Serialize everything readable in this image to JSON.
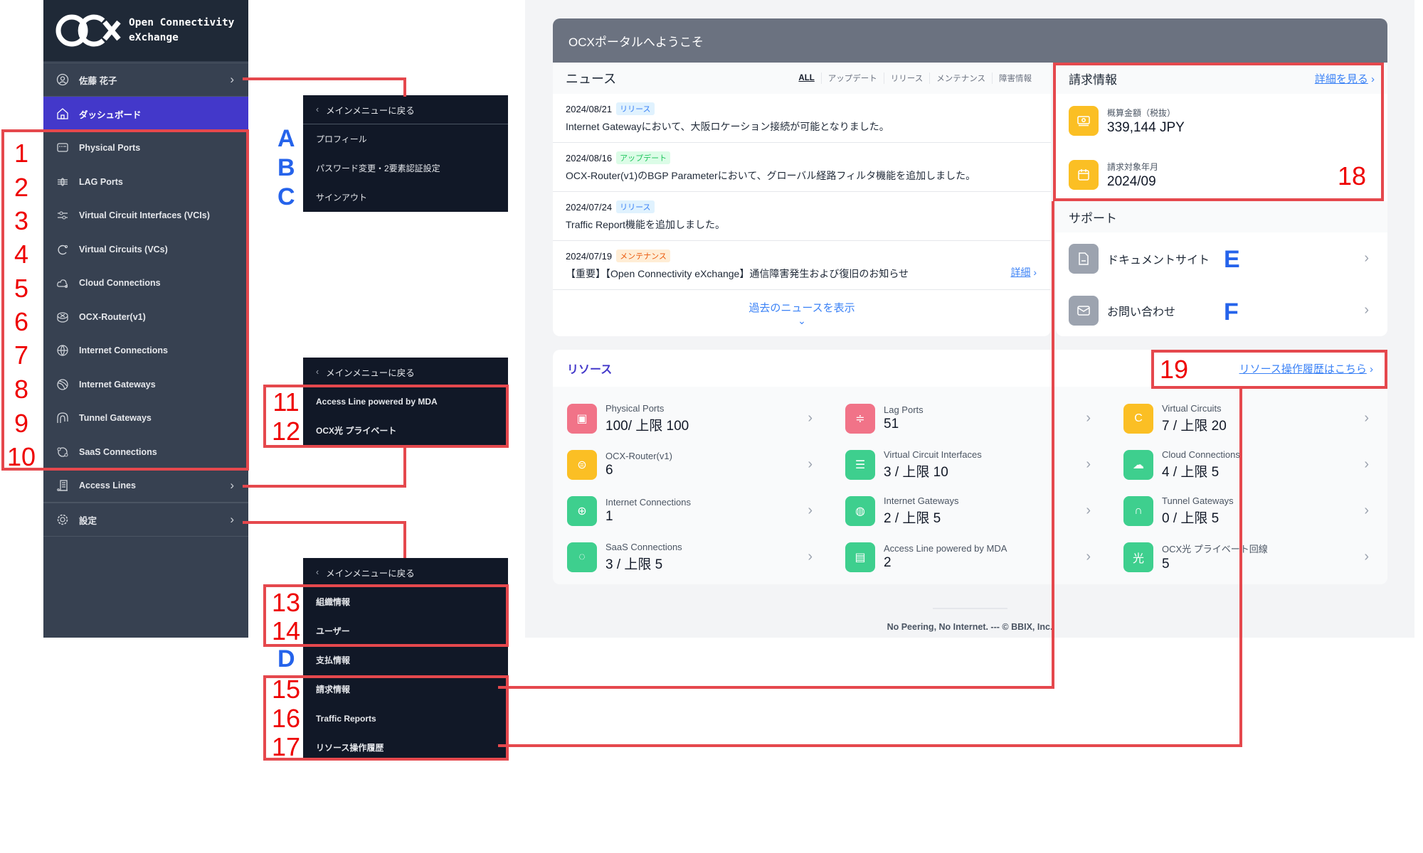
{
  "sidebar": {
    "brand_line1": "Open Connectivity",
    "brand_line2": "eXchange",
    "user_name": "佐藤 花子",
    "dashboard": "ダッシュボード",
    "items": [
      {
        "label": "Physical Ports",
        "icon": "ethernet-port-icon"
      },
      {
        "label": "LAG Ports",
        "icon": "lag-icon"
      },
      {
        "label": "Virtual Circuit Interfaces (VCIs)",
        "icon": "sliders-icon"
      },
      {
        "label": "Virtual Circuits (VCs)",
        "icon": "circuit-icon"
      },
      {
        "label": "Cloud Connections",
        "icon": "cloud-icon"
      },
      {
        "label": "OCX-Router(v1)",
        "icon": "router-icon"
      },
      {
        "label": "Internet Connections",
        "icon": "globe-icon"
      },
      {
        "label": "Internet Gateways",
        "icon": "gateway-icon"
      },
      {
        "label": "Tunnel Gateways",
        "icon": "tunnel-icon"
      },
      {
        "label": "SaaS Connections",
        "icon": "saas-icon"
      }
    ],
    "access_lines": "Access Lines",
    "settings": "設定"
  },
  "popups": {
    "back_label": "メインメニューに戻る",
    "user_menu": [
      "プロフィール",
      "パスワード変更・2要素認証設定",
      "サインアウト"
    ],
    "access_menu": [
      "Access Line powered by MDA",
      "OCX光 プライベート"
    ],
    "settings_menu": [
      "組織情報",
      "ユーザー",
      "支払情報",
      "請求情報",
      "Traffic Reports",
      "リソース操作履歴"
    ]
  },
  "annotations": {
    "numbers": [
      "1",
      "2",
      "3",
      "4",
      "5",
      "6",
      "7",
      "8",
      "9",
      "10",
      "11",
      "12",
      "13",
      "14",
      "15",
      "16",
      "17",
      "18",
      "19"
    ],
    "letters": [
      "A",
      "B",
      "C",
      "D",
      "E",
      "F"
    ]
  },
  "main": {
    "welcome": "OCXポータルへようこそ",
    "news": {
      "title": "ニュース",
      "tabs": [
        "ALL",
        "アップデート",
        "リリース",
        "メンテナンス",
        "障害情報"
      ],
      "items": [
        {
          "date": "2024/08/21",
          "tag": "リリース",
          "text": "Internet Gatewayにおいて、大阪ロケーション接続が可能となりました。"
        },
        {
          "date": "2024/08/16",
          "tag": "アップデート",
          "text": "OCX-Router(v1)のBGP Parameterにおいて、グローバル経路フィルタ機能を追加しました。"
        },
        {
          "date": "2024/07/24",
          "tag": "リリース",
          "text": "Traffic Report機能を追加しました。"
        },
        {
          "date": "2024/07/19",
          "tag": "メンテナンス",
          "text": "【重要】【Open Connectivity eXchange】通信障害発生および復旧のお知らせ",
          "link": "詳細"
        }
      ],
      "more": "過去のニュースを表示"
    },
    "billing": {
      "title": "請求情報",
      "link": "詳細を見る",
      "amount_label": "概算金額（税抜）",
      "amount": "339,144 JPY",
      "period_label": "請求対象年月",
      "period": "2024/09"
    },
    "support": {
      "title": "サポート",
      "items": [
        "ドキュメントサイト",
        "お問い合わせ"
      ]
    },
    "resources": {
      "title": "リソース",
      "link": "リソース操作履歴はこちら",
      "items": [
        {
          "label": "Physical Ports",
          "value": "100/ 上限 100",
          "color": "#f17388"
        },
        {
          "label": "Lag Ports",
          "value": "51",
          "color": "#f17388"
        },
        {
          "label": "Virtual Circuits",
          "value": "7 / 上限 20",
          "color": "#fbbf24"
        },
        {
          "label": "OCX-Router(v1)",
          "value": "6",
          "color": "#fbbf24"
        },
        {
          "label": "Virtual Circuit Interfaces",
          "value": "3 / 上限 10",
          "color": "#3ecf8e"
        },
        {
          "label": "Cloud Connections",
          "value": "4 / 上限 5",
          "color": "#3ecf8e"
        },
        {
          "label": "Internet Connections",
          "value": "1",
          "color": "#3ecf8e"
        },
        {
          "label": "Internet Gateways",
          "value": "2 / 上限 5",
          "color": "#3ecf8e"
        },
        {
          "label": "Tunnel Gateways",
          "value": "0 / 上限 5",
          "color": "#3ecf8e"
        },
        {
          "label": "SaaS Connections",
          "value": "3 / 上限 5",
          "color": "#3ecf8e"
        },
        {
          "label": "Access Line powered by MDA",
          "value": "2",
          "color": "#3ecf8e"
        },
        {
          "label": "OCX光 プライベート回線",
          "value": "5",
          "color": "#3ecf8e"
        }
      ]
    },
    "footer": "No Peering, No Internet. --- © BBIX, Inc."
  },
  "colors": {
    "accent": "#4338ca",
    "annotation_red": "#e5484d",
    "annotation_blue": "#2563eb",
    "release_badge_bg": "#e0f2fe",
    "release_badge_fg": "#3b82f6",
    "update_badge_bg": "#dcfce7",
    "update_badge_fg": "#22c55e",
    "maint_badge_bg": "#ffedd5",
    "maint_badge_fg": "#ea580c"
  }
}
